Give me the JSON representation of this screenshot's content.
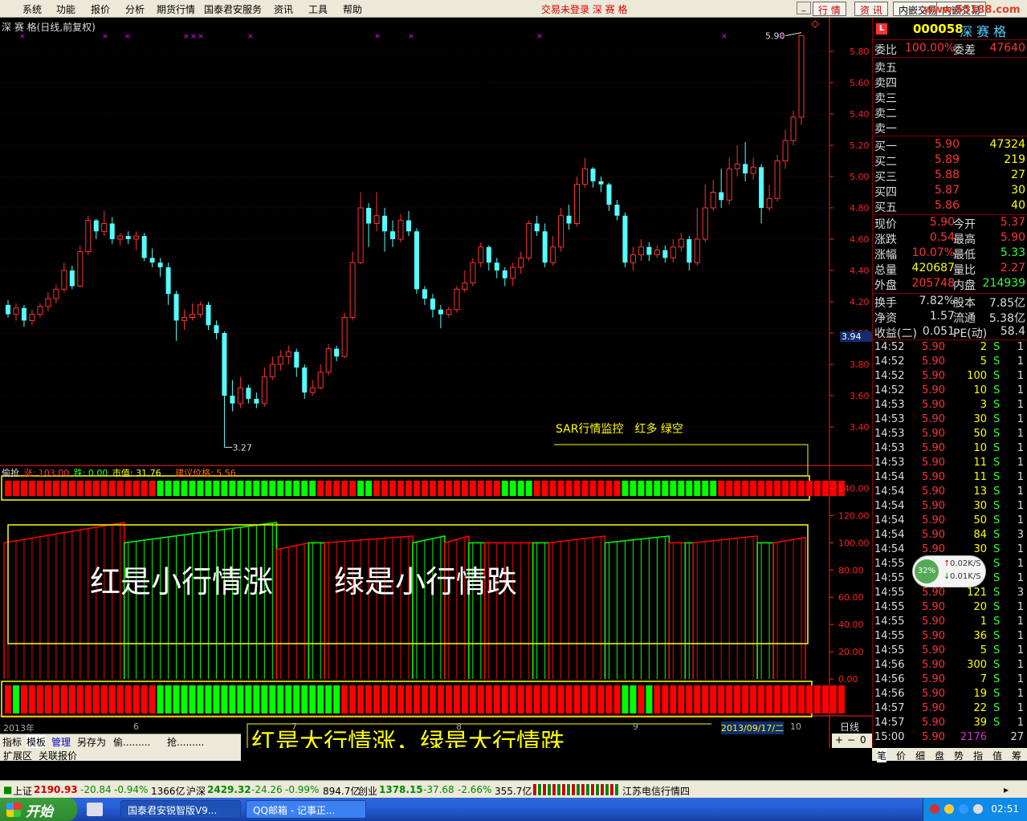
{
  "menu": [
    "系统",
    "功能",
    "报价",
    "分析",
    "期货行情",
    "国泰君安服务",
    "资讯",
    "工具",
    "帮助"
  ],
  "hint": "交易未登录 深 赛 格",
  "top_buttons": [
    "行 情",
    "资 讯",
    "内嵌交易",
    "内嵌交易"
  ],
  "watermark": "www.55188.com",
  "stock_title": "深 赛 格(日线,前复权)",
  "price_axis": [
    "5.80",
    "5.60",
    "5.40",
    "5.20",
    "5.00",
    "4.80",
    "4.60",
    "4.40",
    "4.20",
    "4.00",
    "3.80",
    "3.60",
    "3.40"
  ],
  "cursor_price": "3.94",
  "high_label": "5.90",
  "low_label": "3.27",
  "indicator_line": {
    "name": "偷抢",
    "zhang": "涨: 103.00",
    "die": "跌: 0.00",
    "shizhi": "市值: 31.76",
    "jianyi": "建议价格: 5.56"
  },
  "sub_axis": [
    "140.00",
    "120.00",
    "100.00",
    "80.00",
    "60.00",
    "40.00",
    "20.00",
    "0.00"
  ],
  "annotations": {
    "sar": "SAR行情监控　红多 绿空",
    "small": "红是小行情涨　　绿是小行情跌",
    "big": "红是大行情涨，绿是大行情跌"
  },
  "date_axis": {
    "year": "2013年",
    "m6": "6",
    "m7": "7",
    "m8": "8",
    "m9": "9",
    "m10": "10",
    "cursor_date": "2013/09/17/二",
    "period": "日线"
  },
  "bottom_tabs": [
    "指标",
    "模板",
    "管理",
    "另存为",
    "偷.........",
    "抢........."
  ],
  "expand_tabs": [
    "扩展区",
    "关联报价"
  ],
  "side": {
    "code": "000058",
    "name": "深 赛 格",
    "weibi": {
      "label": "委比",
      "value": "100.00%",
      "label2": "委差",
      "value2": "47640"
    },
    "sells": [
      {
        "label": "卖五"
      },
      {
        "label": "卖四"
      },
      {
        "label": "卖三"
      },
      {
        "label": "卖二"
      },
      {
        "label": "卖一"
      }
    ],
    "buys": [
      {
        "label": "买一",
        "price": "5.90",
        "vol": "47324"
      },
      {
        "label": "买二",
        "price": "5.89",
        "vol": "219"
      },
      {
        "label": "买三",
        "price": "5.88",
        "vol": "27"
      },
      {
        "label": "买四",
        "price": "5.87",
        "vol": "30"
      },
      {
        "label": "买五",
        "price": "5.86",
        "vol": "40"
      }
    ],
    "quote1": [
      {
        "l1": "现价",
        "v1": "5.90",
        "l2": "今开",
        "v2": "5.37",
        "c1": "#f33",
        "c2": "#f33"
      },
      {
        "l1": "涨跌",
        "v1": "0.54",
        "l2": "最高",
        "v2": "5.90",
        "c1": "#f33",
        "c2": "#f33"
      },
      {
        "l1": "涨幅",
        "v1": "10.07%",
        "l2": "最低",
        "v2": "5.33",
        "c1": "#f33",
        "c2": "#3f3"
      },
      {
        "l1": "总量",
        "v1": "420687",
        "l2": "量比",
        "v2": "2.27",
        "c1": "#ff0",
        "c2": "#f33"
      },
      {
        "l1": "外盘",
        "v1": "205748",
        "l2": "内盘",
        "v2": "214939",
        "c1": "#f33",
        "c2": "#3f3"
      }
    ],
    "quote2": [
      {
        "l1": "换手",
        "v1": "7.82%",
        "l2": "股本",
        "v2": "7.85亿"
      },
      {
        "l1": "净资",
        "v1": "1.57",
        "l2": "流通",
        "v2": "5.38亿"
      },
      {
        "l1": "收益(二)",
        "v1": "0.051",
        "l2": "PE(动)",
        "v2": "58.4"
      }
    ],
    "ticks": [
      {
        "t": "14:52",
        "p": "5.90",
        "v": "2",
        "s": "S",
        "n": "1"
      },
      {
        "t": "14:52",
        "p": "5.90",
        "v": "5",
        "s": "S",
        "n": "1"
      },
      {
        "t": "14:52",
        "p": "5.90",
        "v": "100",
        "s": "S",
        "n": "1"
      },
      {
        "t": "14:52",
        "p": "5.90",
        "v": "10",
        "s": "S",
        "n": "1"
      },
      {
        "t": "14:53",
        "p": "5.90",
        "v": "3",
        "s": "S",
        "n": "1"
      },
      {
        "t": "14:53",
        "p": "5.90",
        "v": "30",
        "s": "S",
        "n": "1"
      },
      {
        "t": "14:53",
        "p": "5.90",
        "v": "50",
        "s": "S",
        "n": "1"
      },
      {
        "t": "14:53",
        "p": "5.90",
        "v": "10",
        "s": "S",
        "n": "1"
      },
      {
        "t": "14:53",
        "p": "5.90",
        "v": "11",
        "s": "S",
        "n": "1"
      },
      {
        "t": "14:54",
        "p": "5.90",
        "v": "11",
        "s": "S",
        "n": "1"
      },
      {
        "t": "14:54",
        "p": "5.90",
        "v": "13",
        "s": "S",
        "n": "1"
      },
      {
        "t": "14:54",
        "p": "5.90",
        "v": "30",
        "s": "S",
        "n": "1"
      },
      {
        "t": "14:54",
        "p": "5.90",
        "v": "50",
        "s": "S",
        "n": "1"
      },
      {
        "t": "14:54",
        "p": "5.90",
        "v": "84",
        "s": "S",
        "n": "3"
      },
      {
        "t": "14:54",
        "p": "5.90",
        "v": "30",
        "s": "S",
        "n": "1"
      },
      {
        "t": "14:55",
        "p": "5.90",
        "v": "",
        "s": "S",
        "n": "1"
      },
      {
        "t": "14:55",
        "p": "5.90",
        "v": "",
        "s": "S",
        "n": "1"
      },
      {
        "t": "14:55",
        "p": "5.90",
        "v": "121",
        "s": "S",
        "n": "3"
      },
      {
        "t": "14:55",
        "p": "5.90",
        "v": "20",
        "s": "S",
        "n": "1"
      },
      {
        "t": "14:55",
        "p": "5.90",
        "v": "1",
        "s": "S",
        "n": "1"
      },
      {
        "t": "14:55",
        "p": "5.90",
        "v": "36",
        "s": "S",
        "n": "1"
      },
      {
        "t": "14:55",
        "p": "5.90",
        "v": "5",
        "s": "S",
        "n": "1"
      },
      {
        "t": "14:56",
        "p": "5.90",
        "v": "300",
        "s": "S",
        "n": "1"
      },
      {
        "t": "14:56",
        "p": "5.90",
        "v": "7",
        "s": "S",
        "n": "1"
      },
      {
        "t": "14:56",
        "p": "5.90",
        "v": "19",
        "s": "S",
        "n": "1"
      },
      {
        "t": "14:57",
        "p": "5.90",
        "v": "22",
        "s": "S",
        "n": "1"
      },
      {
        "t": "14:57",
        "p": "5.90",
        "v": "39",
        "s": "S",
        "n": "1"
      },
      {
        "t": "15:00",
        "p": "5.90",
        "v": "2176",
        "s": "",
        "n": "27"
      }
    ],
    "tabs": [
      "笔",
      "价",
      "细",
      "盘",
      "势",
      "指",
      "值",
      "筹"
    ]
  },
  "net_widget": {
    "percent": "32%",
    "up": "0.02K/S",
    "down": "0.01K/S"
  },
  "status_bar": {
    "sh": "上证",
    "sh_v": "2190.93",
    "sh_c": "-20.84",
    "sh_p": "-0.94%",
    "sh_a": "1366亿",
    "hs": "沪深",
    "hs_v": "2429.32",
    "hs_c": "-24.26",
    "hs_p": "-0.99%",
    "hs_a": "894.7亿",
    "cy": "创业",
    "cy_v": "1378.15",
    "cy_c": "-37.68",
    "cy_p": "-2.66%",
    "cy_a": "355.7亿",
    "news": "江苏电信行情四"
  },
  "taskbar": {
    "start": "开始",
    "tasks": [
      "国泰君安锐智版V9...",
      "QQ邮箱 - 记事正..."
    ],
    "clock": "02:51"
  },
  "chart_data": {
    "type": "candlestick",
    "title": "深 赛 格(日线,前复权)",
    "ylim": [
      3.2,
      5.95
    ],
    "candles": [
      [
        4.18,
        4.12,
        4.21,
        4.1
      ],
      [
        4.12,
        4.16,
        4.19,
        4.08
      ],
      [
        4.16,
        4.08,
        4.18,
        4.04
      ],
      [
        4.08,
        4.12,
        4.15,
        4.05
      ],
      [
        4.12,
        4.17,
        4.19,
        4.1
      ],
      [
        4.17,
        4.22,
        4.26,
        4.14
      ],
      [
        4.22,
        4.28,
        4.31,
        4.19
      ],
      [
        4.28,
        4.4,
        4.45,
        4.26
      ],
      [
        4.4,
        4.3,
        4.43,
        4.28
      ],
      [
        4.3,
        4.52,
        4.56,
        4.29
      ],
      [
        4.52,
        4.72,
        4.75,
        4.5
      ],
      [
        4.72,
        4.65,
        4.73,
        4.6
      ],
      [
        4.65,
        4.7,
        4.78,
        4.62
      ],
      [
        4.7,
        4.6,
        4.74,
        4.57
      ],
      [
        4.6,
        4.62,
        4.64,
        4.56
      ],
      [
        4.62,
        4.6,
        4.65,
        4.57
      ],
      [
        4.6,
        4.62,
        4.65,
        4.53
      ],
      [
        4.62,
        4.48,
        4.64,
        4.46
      ],
      [
        4.48,
        4.45,
        4.54,
        4.42
      ],
      [
        4.45,
        4.42,
        4.48,
        4.36
      ],
      [
        4.42,
        4.25,
        4.45,
        4.18
      ],
      [
        4.25,
        4.08,
        4.27,
        3.95
      ],
      [
        4.08,
        4.1,
        4.15,
        4.02
      ],
      [
        4.1,
        4.12,
        4.19,
        4.08
      ],
      [
        4.12,
        4.18,
        4.2,
        4.1
      ],
      [
        4.18,
        4.05,
        4.2,
        4.02
      ],
      [
        4.05,
        4.0,
        4.08,
        3.96
      ],
      [
        4.0,
        3.6,
        4.01,
        3.27
      ],
      [
        3.6,
        3.55,
        3.7,
        3.5
      ],
      [
        3.55,
        3.65,
        3.72,
        3.52
      ],
      [
        3.65,
        3.58,
        3.67,
        3.55
      ],
      [
        3.58,
        3.55,
        3.62,
        3.52
      ],
      [
        3.55,
        3.72,
        3.78,
        3.53
      ],
      [
        3.72,
        3.8,
        3.85,
        3.7
      ],
      [
        3.8,
        3.85,
        3.89,
        3.76
      ],
      [
        3.85,
        3.88,
        3.92,
        3.8
      ],
      [
        3.88,
        3.78,
        3.9,
        3.72
      ],
      [
        3.78,
        3.62,
        3.8,
        3.58
      ],
      [
        3.62,
        3.65,
        3.7,
        3.6
      ],
      [
        3.65,
        3.75,
        3.8,
        3.64
      ],
      [
        3.75,
        3.9,
        3.93,
        3.73
      ],
      [
        3.9,
        3.85,
        3.92,
        3.82
      ],
      [
        3.85,
        4.1,
        4.13,
        3.84
      ],
      [
        4.1,
        4.45,
        4.52,
        4.08
      ],
      [
        4.45,
        4.8,
        4.9,
        4.44
      ],
      [
        4.8,
        4.7,
        4.83,
        4.55
      ],
      [
        4.7,
        4.75,
        4.9,
        4.65
      ],
      [
        4.75,
        4.65,
        4.8,
        4.52
      ],
      [
        4.65,
        4.6,
        4.72,
        4.55
      ],
      [
        4.6,
        4.72,
        4.76,
        4.58
      ],
      [
        4.72,
        4.65,
        4.78,
        4.62
      ],
      [
        4.65,
        4.28,
        4.67,
        4.25
      ],
      [
        4.28,
        4.22,
        4.3,
        4.18
      ],
      [
        4.22,
        4.15,
        4.25,
        4.1
      ],
      [
        4.15,
        4.12,
        4.18,
        4.03
      ],
      [
        4.12,
        4.15,
        4.17,
        4.1
      ],
      [
        4.15,
        4.28,
        4.3,
        4.13
      ],
      [
        4.28,
        4.32,
        4.4,
        4.26
      ],
      [
        4.32,
        4.45,
        4.48,
        4.3
      ],
      [
        4.45,
        4.55,
        4.58,
        4.42
      ],
      [
        4.55,
        4.45,
        4.56,
        4.4
      ],
      [
        4.45,
        4.4,
        4.48,
        4.35
      ],
      [
        4.4,
        4.35,
        4.42,
        4.3
      ],
      [
        4.35,
        4.42,
        4.45,
        4.3
      ],
      [
        4.42,
        4.48,
        4.52,
        4.38
      ],
      [
        4.48,
        4.7,
        4.72,
        4.46
      ],
      [
        4.7,
        4.65,
        4.75,
        4.62
      ],
      [
        4.65,
        4.45,
        4.7,
        4.42
      ],
      [
        4.45,
        4.55,
        4.62,
        4.43
      ],
      [
        4.55,
        4.75,
        4.8,
        4.52
      ],
      [
        4.75,
        4.7,
        4.82,
        4.66
      ],
      [
        4.7,
        4.95,
        5.0,
        4.68
      ],
      [
        4.95,
        5.05,
        5.12,
        4.93
      ],
      [
        5.05,
        4.97,
        5.06,
        4.93
      ],
      [
        4.97,
        4.95,
        5.0,
        4.9
      ],
      [
        4.95,
        4.82,
        4.96,
        4.78
      ],
      [
        4.82,
        4.75,
        4.85,
        4.72
      ],
      [
        4.75,
        4.45,
        4.77,
        4.42
      ],
      [
        4.45,
        4.5,
        4.55,
        4.4
      ],
      [
        4.5,
        4.55,
        4.6,
        4.46
      ],
      [
        4.55,
        4.5,
        4.58,
        4.46
      ],
      [
        4.5,
        4.53,
        4.56,
        4.48
      ],
      [
        4.53,
        4.48,
        4.56,
        4.45
      ],
      [
        4.48,
        4.55,
        4.6,
        4.45
      ],
      [
        4.55,
        4.6,
        4.64,
        4.52
      ],
      [
        4.6,
        4.45,
        4.62,
        4.4
      ],
      [
        4.45,
        4.6,
        4.8,
        4.43
      ],
      [
        4.6,
        4.8,
        4.95,
        4.58
      ],
      [
        4.8,
        4.9,
        4.98,
        4.78
      ],
      [
        4.9,
        4.85,
        5.05,
        4.8
      ],
      [
        4.85,
        5.05,
        5.12,
        4.82
      ],
      [
        5.05,
        5.08,
        5.2,
        5.0
      ],
      [
        5.08,
        5.02,
        5.22,
        4.97
      ],
      [
        5.02,
        5.06,
        5.12,
        4.98
      ],
      [
        5.06,
        4.8,
        5.08,
        4.7
      ],
      [
        4.8,
        4.86,
        4.95,
        4.78
      ],
      [
        4.86,
        5.1,
        5.14,
        4.84
      ],
      [
        5.1,
        5.23,
        5.3,
        5.05
      ],
      [
        5.23,
        5.38,
        5.42,
        5.2
      ],
      [
        5.38,
        5.9,
        5.9,
        5.33
      ]
    ],
    "sar_signal": [
      1,
      1,
      1,
      1,
      1,
      1,
      1,
      1,
      1,
      1,
      1,
      1,
      1,
      1,
      1,
      1,
      1,
      1,
      1,
      0,
      0,
      0,
      0,
      0,
      0,
      0,
      0,
      0,
      0,
      0,
      0,
      0,
      0,
      0,
      0,
      0,
      0,
      0,
      0,
      1,
      1,
      1,
      1,
      1,
      0,
      0,
      1,
      1,
      1,
      1,
      1,
      1,
      1,
      1,
      1,
      1,
      1,
      1,
      1,
      1,
      1,
      1,
      0,
      0,
      0,
      0,
      1,
      1,
      1,
      1,
      1,
      1,
      1,
      1,
      1,
      1,
      1,
      0,
      0,
      0,
      0,
      0,
      0,
      0,
      0,
      0,
      0,
      0,
      0,
      1,
      1,
      1,
      1,
      1,
      1,
      1,
      1,
      1,
      1,
      1,
      1,
      1,
      1,
      1,
      1
    ],
    "big_signal": [
      1,
      0,
      1,
      1,
      1,
      1,
      1,
      1,
      1,
      1,
      1,
      1,
      1,
      1,
      1,
      1,
      1,
      1,
      1,
      0,
      0,
      0,
      0,
      0,
      0,
      0,
      0,
      0,
      0,
      0,
      0,
      0,
      0,
      0,
      0,
      0,
      0,
      0,
      0,
      0,
      0,
      0,
      1,
      1,
      1,
      1,
      1,
      1,
      1,
      1,
      1,
      1,
      1,
      1,
      1,
      1,
      1,
      1,
      1,
      1,
      1,
      1,
      1,
      1,
      1,
      1,
      1,
      1,
      1,
      1,
      1,
      1,
      1,
      1,
      1,
      1,
      1,
      0,
      0,
      1,
      0,
      1,
      1,
      1,
      1,
      1,
      1,
      1,
      1,
      1,
      1,
      1,
      1,
      1,
      1,
      1,
      1,
      1,
      1,
      1,
      1,
      1,
      1,
      1,
      1
    ],
    "small_segments": [
      {
        "c": "r",
        "s": 0,
        "e": 14,
        "a": 100,
        "b": 115
      },
      {
        "c": "g",
        "s": 15,
        "e": 33,
        "a": 100,
        "b": 115
      },
      {
        "c": "r",
        "s": 34,
        "e": 37,
        "a": 95,
        "b": 100
      },
      {
        "c": "g",
        "s": 38,
        "e": 39,
        "a": 100,
        "b": 100
      },
      {
        "c": "r",
        "s": 40,
        "e": 50,
        "a": 100,
        "b": 105
      },
      {
        "c": "g",
        "s": 51,
        "e": 54,
        "a": 100,
        "b": 105
      },
      {
        "c": "r",
        "s": 55,
        "e": 57,
        "a": 100,
        "b": 105
      },
      {
        "c": "g",
        "s": 58,
        "e": 59,
        "a": 100,
        "b": 100
      },
      {
        "c": "r",
        "s": 60,
        "e": 65,
        "a": 100,
        "b": 100
      },
      {
        "c": "g",
        "s": 66,
        "e": 67,
        "a": 100,
        "b": 100
      },
      {
        "c": "r",
        "s": 68,
        "e": 74,
        "a": 100,
        "b": 105
      },
      {
        "c": "g",
        "s": 75,
        "e": 82,
        "a": 100,
        "b": 105
      },
      {
        "c": "r",
        "s": 83,
        "e": 84,
        "a": 100,
        "b": 100
      },
      {
        "c": "g",
        "s": 85,
        "e": 85,
        "a": 100,
        "b": 100
      },
      {
        "c": "r",
        "s": 86,
        "e": 93,
        "a": 100,
        "b": 105
      },
      {
        "c": "g",
        "s": 94,
        "e": 95,
        "a": 100,
        "b": 100
      },
      {
        "c": "r",
        "s": 96,
        "e": 99,
        "a": 100,
        "b": 104
      }
    ]
  },
  "colors": {
    "up": "#ff3232",
    "down": "#54ffff",
    "red": "#ff0000",
    "green": "#00ff00",
    "axis": "#ff2020",
    "yellow": "#ffff00"
  }
}
